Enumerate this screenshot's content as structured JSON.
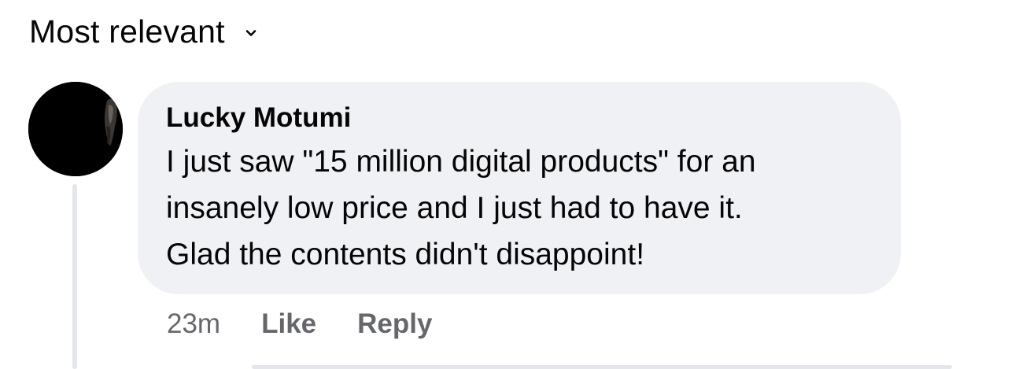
{
  "sort": {
    "label": "Most relevant",
    "icon": "chevron-down-icon"
  },
  "comment": {
    "author": "Lucky Motumi",
    "text": "I just saw \"15 million digital products\" for an\ninsanely low price and I just had to have it.\nGlad the contents didn't disappoint!",
    "time": "23m",
    "like_label": "Like",
    "reply_label": "Reply"
  },
  "colors": {
    "bubble_bg": "#f0f1f5",
    "meta_text": "#65676b",
    "primary_text": "#050505",
    "thread_line": "#e4e6eb"
  }
}
